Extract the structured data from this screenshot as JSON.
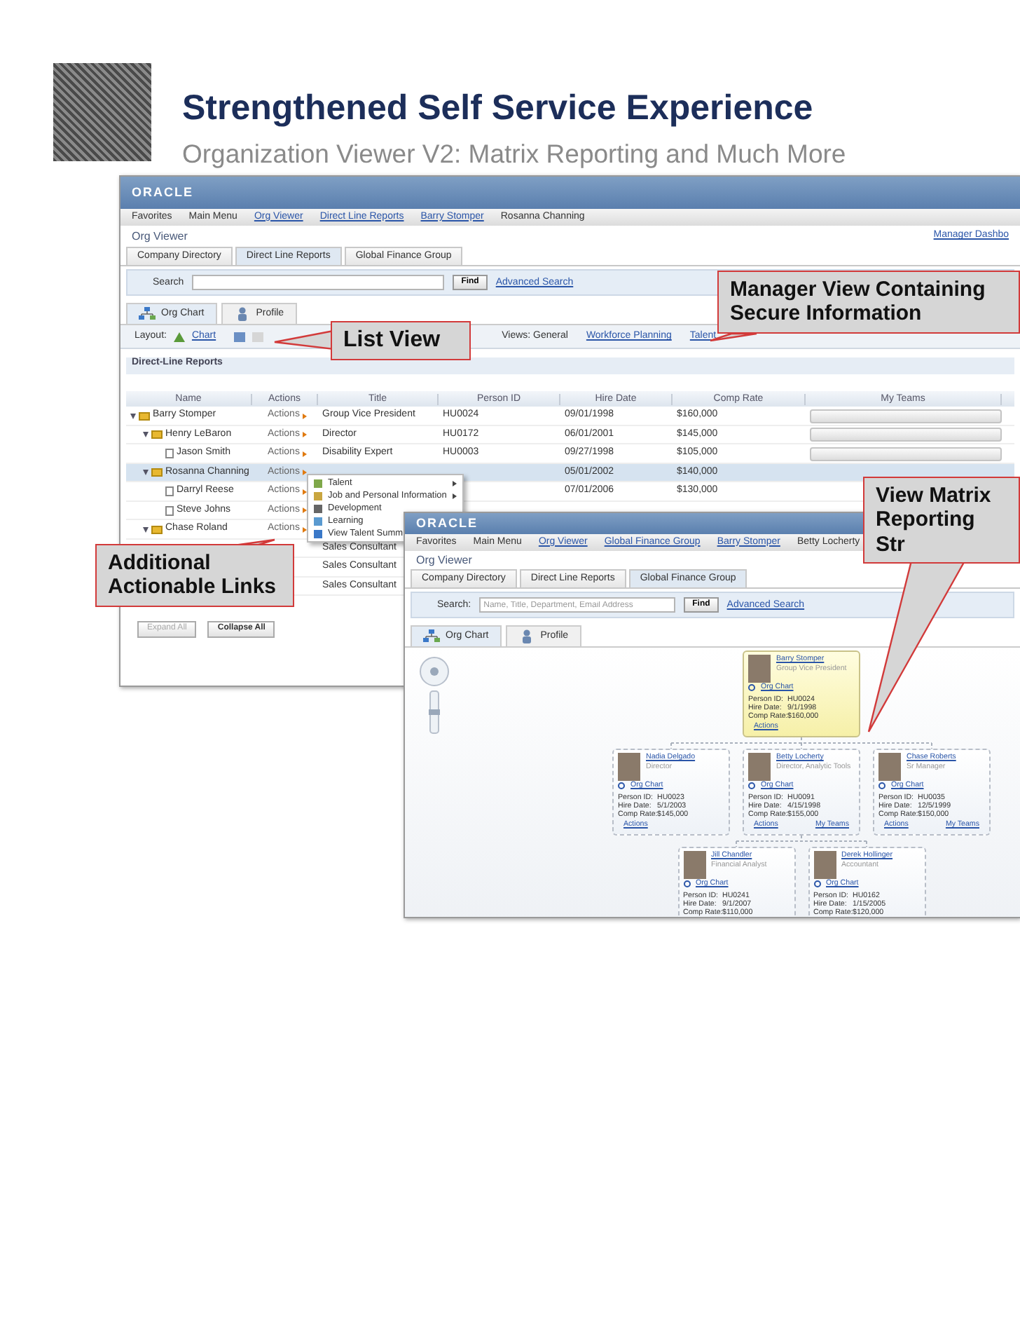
{
  "slide": {
    "title": "Strengthened Self Service Experience",
    "subtitle": "Organization Viewer V2: Matrix Reporting and Much More"
  },
  "list_screen": {
    "logo": "ORACLE",
    "breadcrumb": [
      {
        "label": "Favorites",
        "link": false
      },
      {
        "label": "Main Menu",
        "link": false
      },
      {
        "label": "Org Viewer",
        "link": true
      },
      {
        "label": "Direct Line Reports",
        "link": true
      },
      {
        "label": "Barry Stomper",
        "link": true
      },
      {
        "label": "Rosanna Channing",
        "link": false
      }
    ],
    "page_title": "Org Viewer",
    "header_link": "Manager Dashbo",
    "tabs": [
      {
        "label": "Company Directory",
        "selected": false
      },
      {
        "label": "Direct Line Reports",
        "selected": true
      },
      {
        "label": "Global Finance Group",
        "selected": false
      }
    ],
    "search_label": "Search",
    "find_button": "Find",
    "advanced_search": "Advanced Search",
    "view_tabs": [
      {
        "label": "Org Chart",
        "selected": true
      },
      {
        "label": "Profile",
        "selected": false
      }
    ],
    "layout_label": "Layout:",
    "layout_link": "Chart",
    "views_label": "Views: General",
    "view_links": [
      "Workforce Planning",
      "Talent"
    ],
    "section_title": "Direct-Line Reports",
    "columns": [
      "Name",
      "Actions",
      "Title",
      "Person ID",
      "Hire Date",
      "Comp Rate",
      "My Teams"
    ],
    "rows": [
      {
        "name": "Barry Stomper",
        "expanded": true,
        "selected": false,
        "actions": "Actions",
        "title": "Group Vice President",
        "person_id": "HU0024",
        "hire_date": "09/01/1998",
        "comp_rate": "$160,000",
        "children": [
          {
            "name": "Henry LeBaron",
            "expanded": true,
            "selected": false,
            "actions": "Actions",
            "title": "Director",
            "person_id": "HU0172",
            "hire_date": "06/01/2001",
            "comp_rate": "$145,000",
            "children": [
              {
                "name": "Jason Smith",
                "selected": false,
                "actions": "Actions",
                "title": "Disability Expert",
                "person_id": "HU0003",
                "hire_date": "09/27/1998",
                "comp_rate": "$105,000"
              }
            ]
          },
          {
            "name": "Rosanna Channing",
            "expanded": true,
            "selected": true,
            "actions": "Actions",
            "hire_date": "05/01/2002",
            "comp_rate": "$140,000",
            "children": [
              {
                "name": "Darryl Reese",
                "selected": false,
                "actions": "Actions",
                "hire_date": "07/01/2006",
                "comp_rate": "$130,000"
              },
              {
                "name": "Steve Johns",
                "selected": false,
                "actions": "Actions"
              }
            ]
          },
          {
            "name": "Chase Roland",
            "expanded": true,
            "selected": false,
            "actions": "Actions",
            "children": [
              {
                "selected": false,
                "title": "Sales Consultant"
              },
              {
                "selected": false,
                "title": "Sales Consultant"
              },
              {
                "selected": false,
                "title": "Sales Consultant"
              }
            ]
          }
        ]
      }
    ],
    "actions_menu": [
      {
        "label": "Talent",
        "submenu": true
      },
      {
        "label": "Job and Personal Information",
        "submenu": true
      },
      {
        "label": "Development",
        "submenu": false
      },
      {
        "label": "Learning",
        "submenu": false
      },
      {
        "label": "View Talent Summ",
        "submenu": false
      }
    ],
    "buttons": [
      {
        "label": "Expand All",
        "disabled": true
      },
      {
        "label": "Collapse All",
        "disabled": false
      }
    ]
  },
  "chart_screen": {
    "logo": "ORACLE",
    "breadcrumb": [
      {
        "label": "Favorites",
        "link": false
      },
      {
        "label": "Main Menu",
        "link": false
      },
      {
        "label": "Org Viewer",
        "link": true
      },
      {
        "label": "Global Finance Group",
        "link": true
      },
      {
        "label": "Barry Stomper",
        "link": true
      },
      {
        "label": "Betty Locherty",
        "link": false
      }
    ],
    "page_title": "Org Viewer",
    "tabs": [
      {
        "label": "Company Directory",
        "selected": false
      },
      {
        "label": "Direct Line Reports",
        "selected": false
      },
      {
        "label": "Global Finance Group",
        "selected": true
      }
    ],
    "search_label": "Search:",
    "search_placeholder": "Name, Title, Department, Email Address",
    "find_button": "Find",
    "advanced_search": "Advanced Search",
    "view_tabs": [
      {
        "label": "Org Chart",
        "selected": true
      },
      {
        "label": "Profile",
        "selected": false
      }
    ],
    "org_chart": {
      "name": "Barry Stomper",
      "title": "Group Vice President",
      "link": "Org Chart",
      "selected": true,
      "fields": [
        {
          "label": "Person ID:",
          "value": "HU0024"
        },
        {
          "label": "Hire Date:",
          "value": "9/1/1998"
        },
        {
          "label": "Comp Rate:",
          "value": "$160,000"
        }
      ],
      "actions": "Actions",
      "children": [
        {
          "name": "Nadia Delgado",
          "title": "Director",
          "link": "Org Chart",
          "selected": false,
          "fields": [
            {
              "label": "Person ID:",
              "value": "HU0023"
            },
            {
              "label": "Hire Date:",
              "value": "5/1/2003"
            },
            {
              "label": "Comp Rate:",
              "value": "$145,000"
            }
          ],
          "actions": "Actions"
        },
        {
          "name": "Betty Locherty",
          "title": "Director, Analytic Tools",
          "link": "Org Chart",
          "selected": false,
          "fields": [
            {
              "label": "Person ID:",
              "value": "HU0091"
            },
            {
              "label": "Hire Date:",
              "value": "4/15/1998"
            },
            {
              "label": "Comp Rate:",
              "value": "$155,000"
            }
          ],
          "actions": "Actions",
          "my_teams": "My Teams",
          "children": [
            {
              "name": "Jill Chandler",
              "title": "Financial Analyst",
              "link": "Org Chart",
              "selected": false,
              "fields": [
                {
                  "label": "Person ID:",
                  "value": "HU0241"
                },
                {
                  "label": "Hire Date:",
                  "value": "9/1/2007"
                },
                {
                  "label": "Comp Rate:",
                  "value": "$110,000"
                }
              ]
            },
            {
              "name": "Derek Hollinger",
              "title": "Accountant",
              "link": "Org Chart",
              "selected": false,
              "fields": [
                {
                  "label": "Person ID:",
                  "value": "HU0162"
                },
                {
                  "label": "Hire Date:",
                  "value": "1/15/2005"
                },
                {
                  "label": "Comp Rate:",
                  "value": "$120,000"
                }
              ]
            }
          ]
        },
        {
          "name": "Chase Roberts",
          "title": "Sr Manager",
          "link": "Org Chart",
          "selected": false,
          "fields": [
            {
              "label": "Person ID:",
              "value": "HU0035"
            },
            {
              "label": "Hire Date:",
              "value": "12/5/1999"
            },
            {
              "label": "Comp Rate:",
              "value": "$150,000"
            }
          ],
          "actions": "Actions",
          "my_teams": "My Teams"
        }
      ]
    }
  },
  "callouts": [
    {
      "text": "List View"
    },
    {
      "text": "Manager View Containing Secure Information"
    },
    {
      "text": "View Matrix Reporting Str"
    },
    {
      "text": "Additional Actionable Links"
    }
  ]
}
